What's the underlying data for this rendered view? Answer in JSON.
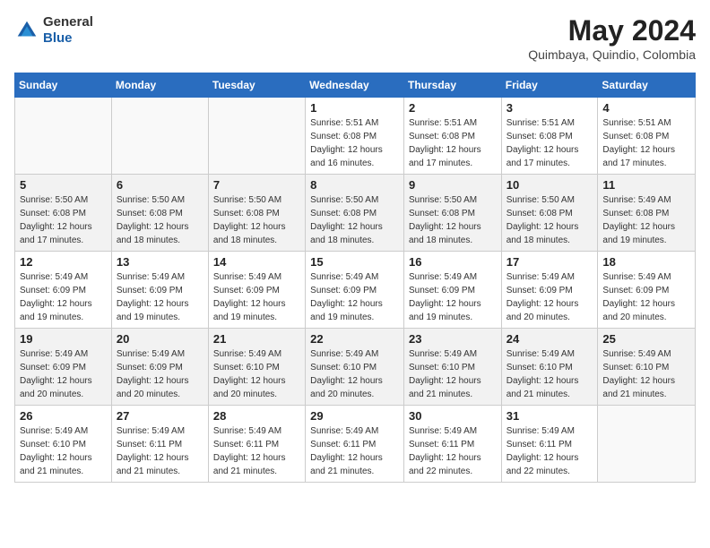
{
  "header": {
    "logo_general": "General",
    "logo_blue": "Blue",
    "month_year": "May 2024",
    "location": "Quimbaya, Quindio, Colombia"
  },
  "days_of_week": [
    "Sunday",
    "Monday",
    "Tuesday",
    "Wednesday",
    "Thursday",
    "Friday",
    "Saturday"
  ],
  "weeks": [
    [
      {
        "day": "",
        "info": ""
      },
      {
        "day": "",
        "info": ""
      },
      {
        "day": "",
        "info": ""
      },
      {
        "day": "1",
        "info": "Sunrise: 5:51 AM\nSunset: 6:08 PM\nDaylight: 12 hours and 16 minutes."
      },
      {
        "day": "2",
        "info": "Sunrise: 5:51 AM\nSunset: 6:08 PM\nDaylight: 12 hours and 17 minutes."
      },
      {
        "day": "3",
        "info": "Sunrise: 5:51 AM\nSunset: 6:08 PM\nDaylight: 12 hours and 17 minutes."
      },
      {
        "day": "4",
        "info": "Sunrise: 5:51 AM\nSunset: 6:08 PM\nDaylight: 12 hours and 17 minutes."
      }
    ],
    [
      {
        "day": "5",
        "info": "Sunrise: 5:50 AM\nSunset: 6:08 PM\nDaylight: 12 hours and 17 minutes."
      },
      {
        "day": "6",
        "info": "Sunrise: 5:50 AM\nSunset: 6:08 PM\nDaylight: 12 hours and 18 minutes."
      },
      {
        "day": "7",
        "info": "Sunrise: 5:50 AM\nSunset: 6:08 PM\nDaylight: 12 hours and 18 minutes."
      },
      {
        "day": "8",
        "info": "Sunrise: 5:50 AM\nSunset: 6:08 PM\nDaylight: 12 hours and 18 minutes."
      },
      {
        "day": "9",
        "info": "Sunrise: 5:50 AM\nSunset: 6:08 PM\nDaylight: 12 hours and 18 minutes."
      },
      {
        "day": "10",
        "info": "Sunrise: 5:50 AM\nSunset: 6:08 PM\nDaylight: 12 hours and 18 minutes."
      },
      {
        "day": "11",
        "info": "Sunrise: 5:49 AM\nSunset: 6:08 PM\nDaylight: 12 hours and 19 minutes."
      }
    ],
    [
      {
        "day": "12",
        "info": "Sunrise: 5:49 AM\nSunset: 6:09 PM\nDaylight: 12 hours and 19 minutes."
      },
      {
        "day": "13",
        "info": "Sunrise: 5:49 AM\nSunset: 6:09 PM\nDaylight: 12 hours and 19 minutes."
      },
      {
        "day": "14",
        "info": "Sunrise: 5:49 AM\nSunset: 6:09 PM\nDaylight: 12 hours and 19 minutes."
      },
      {
        "day": "15",
        "info": "Sunrise: 5:49 AM\nSunset: 6:09 PM\nDaylight: 12 hours and 19 minutes."
      },
      {
        "day": "16",
        "info": "Sunrise: 5:49 AM\nSunset: 6:09 PM\nDaylight: 12 hours and 19 minutes."
      },
      {
        "day": "17",
        "info": "Sunrise: 5:49 AM\nSunset: 6:09 PM\nDaylight: 12 hours and 20 minutes."
      },
      {
        "day": "18",
        "info": "Sunrise: 5:49 AM\nSunset: 6:09 PM\nDaylight: 12 hours and 20 minutes."
      }
    ],
    [
      {
        "day": "19",
        "info": "Sunrise: 5:49 AM\nSunset: 6:09 PM\nDaylight: 12 hours and 20 minutes."
      },
      {
        "day": "20",
        "info": "Sunrise: 5:49 AM\nSunset: 6:09 PM\nDaylight: 12 hours and 20 minutes."
      },
      {
        "day": "21",
        "info": "Sunrise: 5:49 AM\nSunset: 6:10 PM\nDaylight: 12 hours and 20 minutes."
      },
      {
        "day": "22",
        "info": "Sunrise: 5:49 AM\nSunset: 6:10 PM\nDaylight: 12 hours and 20 minutes."
      },
      {
        "day": "23",
        "info": "Sunrise: 5:49 AM\nSunset: 6:10 PM\nDaylight: 12 hours and 21 minutes."
      },
      {
        "day": "24",
        "info": "Sunrise: 5:49 AM\nSunset: 6:10 PM\nDaylight: 12 hours and 21 minutes."
      },
      {
        "day": "25",
        "info": "Sunrise: 5:49 AM\nSunset: 6:10 PM\nDaylight: 12 hours and 21 minutes."
      }
    ],
    [
      {
        "day": "26",
        "info": "Sunrise: 5:49 AM\nSunset: 6:10 PM\nDaylight: 12 hours and 21 minutes."
      },
      {
        "day": "27",
        "info": "Sunrise: 5:49 AM\nSunset: 6:11 PM\nDaylight: 12 hours and 21 minutes."
      },
      {
        "day": "28",
        "info": "Sunrise: 5:49 AM\nSunset: 6:11 PM\nDaylight: 12 hours and 21 minutes."
      },
      {
        "day": "29",
        "info": "Sunrise: 5:49 AM\nSunset: 6:11 PM\nDaylight: 12 hours and 21 minutes."
      },
      {
        "day": "30",
        "info": "Sunrise: 5:49 AM\nSunset: 6:11 PM\nDaylight: 12 hours and 22 minutes."
      },
      {
        "day": "31",
        "info": "Sunrise: 5:49 AM\nSunset: 6:11 PM\nDaylight: 12 hours and 22 minutes."
      },
      {
        "day": "",
        "info": ""
      }
    ]
  ]
}
